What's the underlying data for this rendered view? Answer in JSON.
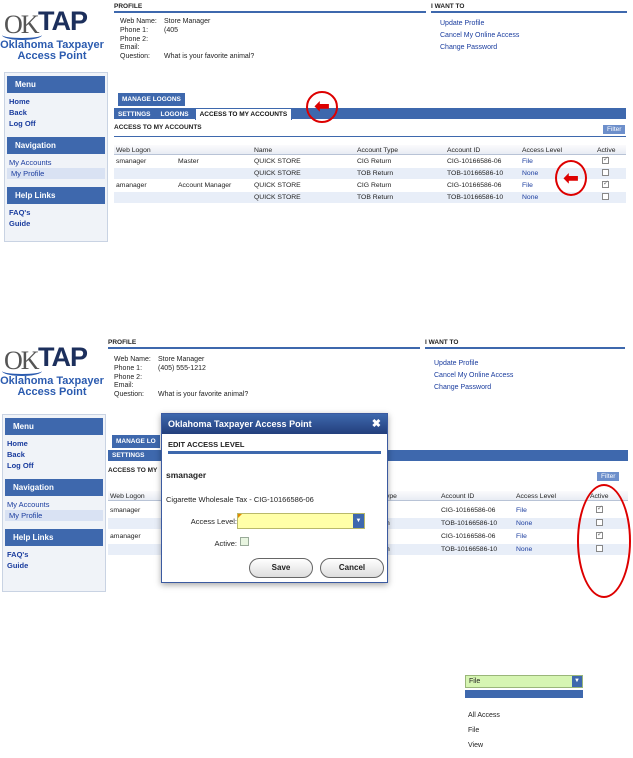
{
  "logo": {
    "ok": "OK",
    "tap": "TAP",
    "line1": "Oklahoma Taxpayer",
    "line2": "Access Point"
  },
  "sidebar": {
    "menu_title": "Menu",
    "menu_items": [
      "Home",
      "Back",
      "Log Off"
    ],
    "nav_title": "Navigation",
    "nav_items": [
      "My Accounts",
      "My Profile"
    ],
    "help_title": "Help Links",
    "help_items": [
      "FAQ's",
      "Guide"
    ]
  },
  "profile": {
    "title": "PROFILE",
    "labels": [
      "Web Name:",
      "Phone 1:",
      "Phone 2:",
      "Email:",
      "Question:"
    ],
    "values_top": [
      "Store Manager",
      "(405",
      "",
      "",
      "What is your favorite animal?"
    ],
    "values_bottom": [
      "Store Manager",
      "(405) 555-1212",
      "",
      "",
      "What is your favorite animal?"
    ]
  },
  "i_want_to": {
    "title": "I WANT TO",
    "links": [
      "Update Profile",
      "Cancel My Online Access",
      "Change Password"
    ]
  },
  "manage_logons": "MANAGE LOGONS",
  "manage_logons_cut": "MANAGE LO",
  "tabs": [
    "SETTINGS",
    "LOGONS",
    "ACCESS TO MY ACCOUNTS"
  ],
  "access_title": "ACCESS TO MY ACCOUNTS",
  "access_title_cut": "ACCESS TO MY",
  "filter_label": "Filter",
  "table": {
    "headers": [
      "Web Logon",
      "",
      "Name",
      "Account Type",
      "Account ID",
      "Access Level",
      "Active"
    ],
    "rows": [
      {
        "logon": "smanager",
        "role": "Master",
        "name": "QUICK STORE",
        "type": "CIG Return",
        "id": "CIG-10166586-06",
        "level": "File",
        "active": true
      },
      {
        "logon": "",
        "role": "",
        "name": "QUICK STORE",
        "type": "TOB Return",
        "id": "TOB-10166586-10",
        "level": "None",
        "active": false
      },
      {
        "logon": "amanager",
        "role": "Account Manager",
        "name": "QUICK STORE",
        "type": "CIG Return",
        "id": "CIG-10166586-06",
        "level": "File",
        "active": true
      },
      {
        "logon": "",
        "role": "",
        "name": "QUICK STORE",
        "type": "TOB Return",
        "id": "TOB-10166586-10",
        "level": "None",
        "active": false
      }
    ],
    "type_fragments": [
      "ype",
      "n",
      "n"
    ]
  },
  "modal": {
    "title": "Oklahoma Taxpayer Access Point",
    "subtitle": "EDIT ACCESS LEVEL",
    "user": "smanager",
    "account": "Cigarette Wholesale Tax - CIG-10166586-06",
    "access_label": "Access Level:",
    "access_value": "",
    "active_label": "Active:",
    "save": "Save",
    "cancel": "Cancel"
  },
  "dropdown_detail": {
    "selected": "File",
    "options": [
      "All Access",
      "File",
      "View"
    ]
  },
  "colors": {
    "brand_blue": "#3e68ad",
    "link_blue": "#1a3c9e",
    "annotation_red": "#dd0000",
    "select_yellow": "#ffffa8"
  }
}
